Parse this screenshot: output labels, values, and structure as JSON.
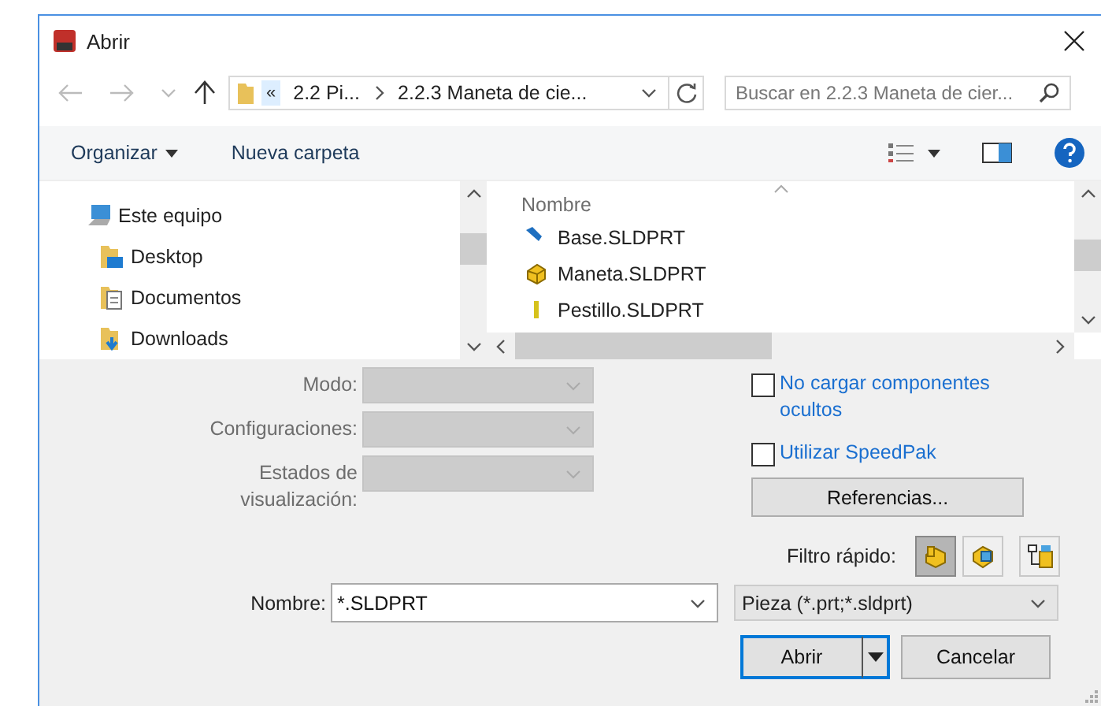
{
  "window": {
    "title": "Abrir"
  },
  "nav": {
    "overflow": "«",
    "path": [
      {
        "label": "2.2 Pi..."
      },
      {
        "label": "2.2.3 Maneta de cie..."
      }
    ],
    "search": {
      "placeholder": "Buscar en 2.2.3 Maneta de cier..."
    }
  },
  "toolbar": {
    "organize": "Organizar",
    "new_folder": "Nueva carpeta"
  },
  "sidebar": {
    "items": [
      {
        "label": "Este equipo",
        "kind": "computer",
        "children": [
          {
            "label": "Desktop",
            "kind": "desktop"
          },
          {
            "label": "Documentos",
            "kind": "documents"
          },
          {
            "label": "Downloads",
            "kind": "downloads"
          }
        ]
      }
    ]
  },
  "file_list": {
    "columns": [
      "Nombre"
    ],
    "files": [
      {
        "name": "Base.SLDPRT",
        "kind": "blue-part"
      },
      {
        "name": "Maneta.SLDPRT",
        "kind": "yellow-part"
      },
      {
        "name": "Pestillo.SLDPRT",
        "kind": "thin-part"
      }
    ]
  },
  "options": {
    "fields": [
      {
        "label": "Modo:",
        "disabled": true
      },
      {
        "label": "Configuraciones:",
        "disabled": true
      },
      {
        "label": "Estados de visualización:",
        "disabled": true
      }
    ],
    "checkboxes": [
      {
        "label": "No cargar componentes ocultos",
        "checked": false
      },
      {
        "label": "Utilizar SpeedPak",
        "checked": false
      }
    ],
    "references_button": "Referencias..."
  },
  "quick_filter": {
    "label": "Filtro rápido:",
    "buttons": [
      {
        "kind": "part",
        "selected": true
      },
      {
        "kind": "assembly",
        "selected": false
      },
      {
        "kind": "drawing",
        "selected": false
      }
    ]
  },
  "file_name": {
    "label": "Nombre:",
    "value": "*.SLDPRT"
  },
  "file_type": {
    "value": "Pieza (*.prt;*.sldprt)"
  },
  "buttons": [
    {
      "label": "Abrir",
      "kind": "split",
      "default": true
    },
    {
      "label": "Cancelar",
      "kind": "plain",
      "default": false
    }
  ]
}
